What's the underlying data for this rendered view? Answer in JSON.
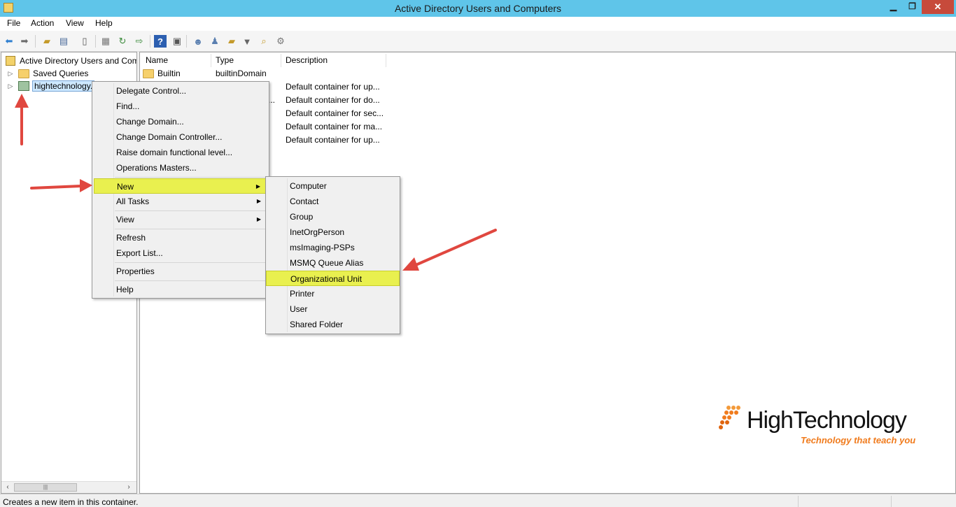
{
  "window": {
    "title": "Active Directory Users and Computers"
  },
  "menubar": [
    "File",
    "Action",
    "View",
    "Help"
  ],
  "toolbar_icons": [
    "back-arrow-icon",
    "forward-arrow-icon",
    "up-folder-icon",
    "show-hide-tree-icon",
    "clipboard-icon",
    "export-list-icon",
    "refresh-icon",
    "export-icon",
    "help-icon",
    "properties-icon",
    "new-user-icon",
    "new-group-icon",
    "new-ou-icon",
    "filter-icon",
    "find-icon",
    "delegate-icon"
  ],
  "tree": {
    "root": "Active Directory Users and Com",
    "items": [
      {
        "label": "Saved Queries"
      },
      {
        "label": "hightechnology."
      }
    ]
  },
  "list": {
    "columns": [
      "Name",
      "Type",
      "Description"
    ],
    "rows": [
      {
        "name": "Builtin",
        "type": "builtinDomain",
        "description": ""
      },
      {
        "name": "",
        "type": "",
        "description": "Default container for up..."
      },
      {
        "name": "",
        "type": "...",
        "description": "Default container for do..."
      },
      {
        "name": "",
        "type": "",
        "description": "Default container for sec..."
      },
      {
        "name": "",
        "type": "",
        "description": "Default container for ma..."
      },
      {
        "name": "",
        "type": "",
        "description": "Default container for up..."
      }
    ]
  },
  "context_menu": {
    "items": [
      {
        "label": "Delegate Control..."
      },
      {
        "label": "Find..."
      },
      {
        "label": "Change Domain..."
      },
      {
        "label": "Change Domain Controller..."
      },
      {
        "label": "Raise domain functional level..."
      },
      {
        "label": "Operations Masters..."
      },
      {
        "label": "New",
        "submenu": true,
        "highlighted": true
      },
      {
        "label": "All Tasks",
        "submenu": true
      },
      {
        "label": "View",
        "submenu": true
      },
      {
        "label": "Refresh"
      },
      {
        "label": "Export List..."
      },
      {
        "label": "Properties"
      },
      {
        "label": "Help"
      }
    ]
  },
  "new_submenu": {
    "items": [
      {
        "label": "Computer"
      },
      {
        "label": "Contact"
      },
      {
        "label": "Group"
      },
      {
        "label": "InetOrgPerson"
      },
      {
        "label": "msImaging-PSPs"
      },
      {
        "label": "MSMQ Queue Alias"
      },
      {
        "label": "Organizational Unit",
        "highlighted": true
      },
      {
        "label": "Printer"
      },
      {
        "label": "User"
      },
      {
        "label": "Shared Folder"
      }
    ]
  },
  "status": {
    "text": "Creates a new item in this container."
  },
  "watermark": {
    "title": "HighTechnology",
    "tagline": "Technology that teach you"
  },
  "colors": {
    "titlebar": "#5fc5e9",
    "highlight": "#e9f04f",
    "annotation_arrow": "#e0473f",
    "logo_accent": "#f07b1d"
  }
}
